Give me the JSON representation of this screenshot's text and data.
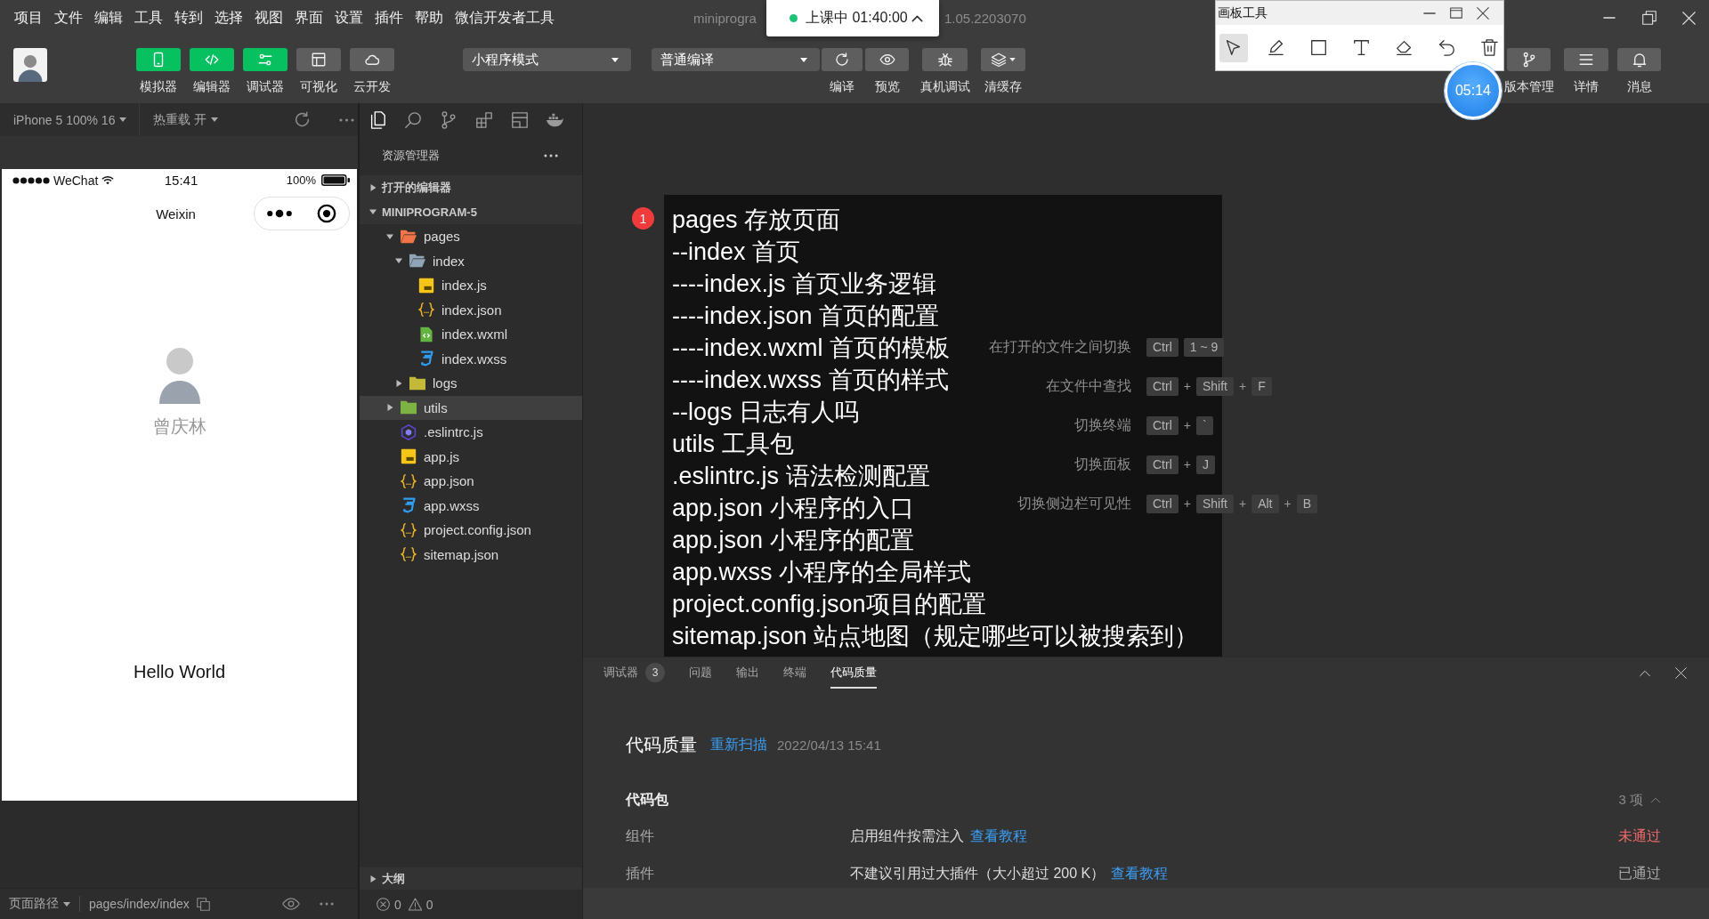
{
  "menu_bar": {
    "items": [
      "项目",
      "文件",
      "编辑",
      "工具",
      "转到",
      "选择",
      "视图",
      "界面",
      "设置",
      "插件",
      "帮助",
      "微信开发者工具"
    ],
    "title": "miniprogra",
    "version": "1.05.2203070"
  },
  "class_timer": {
    "label": "上课中 01:40:00"
  },
  "drawing_tool": {
    "title": "画板工具",
    "tools": [
      {
        "selected": true
      },
      {
        "selected": false
      },
      {
        "selected": false
      },
      {
        "selected": false
      },
      {
        "selected": false
      },
      {
        "selected": false
      },
      {
        "selected": false
      }
    ]
  },
  "timer_bubble": "05:14",
  "toolbar": {
    "view_buttons": [
      {
        "label": "模拟器",
        "on": true
      },
      {
        "label": "编辑器",
        "on": true
      },
      {
        "label": "调试器",
        "on": true
      },
      {
        "label": "可视化",
        "on": false
      },
      {
        "label": "云开发",
        "on": false
      }
    ],
    "mode_select": "小程序模式",
    "compile_select": "普通编译",
    "actions": [
      {
        "label": "编译"
      },
      {
        "label": "预览"
      },
      {
        "label": "真机调试"
      },
      {
        "label": "清缓存"
      }
    ],
    "right_actions": [
      {
        "label": "版本管理"
      },
      {
        "label": "详情"
      },
      {
        "label": "消息"
      }
    ]
  },
  "simulator": {
    "device": "iPhone 5 100% 16",
    "hot_reload": "热重载 开",
    "status_bar": {
      "carrier": "WeChat",
      "time": "15:41",
      "battery": "100%"
    },
    "nav_title": "Weixin",
    "user_name": "曾庆林",
    "greeting": "Hello World",
    "path_label": "页面路径",
    "path": "pages/index/index"
  },
  "explorer": {
    "title": "资源管理器",
    "sections": [
      {
        "label": "打开的编辑器",
        "expanded": false
      },
      {
        "label": "MINIPROGRAM-5",
        "expanded": true,
        "children": [
          {
            "name": "pages",
            "kind": "folder",
            "color": "#f07448",
            "expanded": true,
            "selected": false,
            "children": [
              {
                "name": "index",
                "kind": "folder",
                "color": "#90a4b8",
                "expanded": true,
                "selected": false,
                "children": [
                  {
                    "name": "index.js",
                    "kind": "js",
                    "selected": false
                  },
                  {
                    "name": "index.json",
                    "kind": "json",
                    "selected": false
                  },
                  {
                    "name": "index.wxml",
                    "kind": "wxml",
                    "selected": false
                  },
                  {
                    "name": "index.wxss",
                    "kind": "wxss",
                    "selected": false
                  }
                ]
              },
              {
                "name": "logs",
                "kind": "folder",
                "color": "#c4b83a",
                "expanded": false,
                "selected": false
              }
            ]
          },
          {
            "name": "utils",
            "kind": "folder",
            "color": "#7cb342",
            "expanded": false,
            "selected": true
          },
          {
            "name": ".eslintrc.js",
            "kind": "eslint",
            "selected": false
          },
          {
            "name": "app.js",
            "kind": "js",
            "selected": false
          },
          {
            "name": "app.json",
            "kind": "json",
            "selected": false
          },
          {
            "name": "app.wxss",
            "kind": "wxss",
            "selected": false
          },
          {
            "name": "project.config.json",
            "kind": "json",
            "selected": false
          },
          {
            "name": "sitemap.json",
            "kind": "json",
            "selected": false
          }
        ]
      }
    ],
    "outline": {
      "label": "大纲",
      "expanded": false
    },
    "problems": {
      "errors": "0",
      "warnings": "0"
    }
  },
  "editor": {
    "shortcuts": [
      {
        "label": "在打开的文件之间切换",
        "keys": [
          {
            "key": "Ctrl"
          },
          {
            "key": "1 ~ 9"
          }
        ]
      },
      {
        "label": "在文件中查找",
        "keys": [
          {
            "key": "Ctrl"
          },
          {
            "joiner": "+",
            "key": "Shift"
          },
          {
            "joiner": "+",
            "key": "F"
          }
        ]
      },
      {
        "label": "切换终端",
        "keys": [
          {
            "key": "Ctrl"
          },
          {
            "joiner": "+",
            "key": "`"
          }
        ]
      },
      {
        "label": "切换面板",
        "keys": [
          {
            "key": "Ctrl"
          },
          {
            "joiner": "+",
            "key": "J"
          }
        ]
      },
      {
        "label": "切换侧边栏可见性",
        "keys": [
          {
            "key": "Ctrl"
          },
          {
            "joiner": "+",
            "key": "Shift"
          },
          {
            "joiner": "+",
            "key": "Alt"
          },
          {
            "joiner": "+",
            "key": "B"
          }
        ]
      }
    ],
    "annotation": {
      "number": "1",
      "lines": [
        "pages 存放页面",
        "--index 首页",
        "----index.js 首页业务逻辑",
        "----index.json 首页的配置",
        "----index.wxml 首页的模板",
        "----index.wxss 首页的样式",
        "--logs 日志有人吗",
        "utils 工具包",
        ".eslintrc.js 语法检测配置",
        "app.json 小程序的入口",
        "app.json 小程序的配置",
        "app.wxss 小程序的全局样式",
        "project.config.json项目的配置",
        "sitemap.json 站点地图（规定哪些可以被搜索到）"
      ]
    }
  },
  "bottom_panel": {
    "tabs": [
      {
        "label": "调试器",
        "badge": "3",
        "selected": false
      },
      {
        "label": "问题",
        "selected": false
      },
      {
        "label": "输出",
        "selected": false
      },
      {
        "label": "终端",
        "selected": false
      },
      {
        "label": "代码质量",
        "selected": true
      }
    ],
    "title": "代码质量",
    "rescan": "重新扫描",
    "timestamp": "2022/04/13 15:41",
    "group": {
      "title": "代码包",
      "count": "3 项",
      "expanded": true,
      "rows": [
        {
          "name": "组件",
          "description": "启用组件按需注入",
          "link": "查看教程",
          "status": "未通过",
          "passed": false
        },
        {
          "name": "插件",
          "description": "不建议引用过大插件（大小超过 200 K）",
          "link": "查看教程",
          "status": "已通过",
          "passed": true
        }
      ]
    }
  }
}
